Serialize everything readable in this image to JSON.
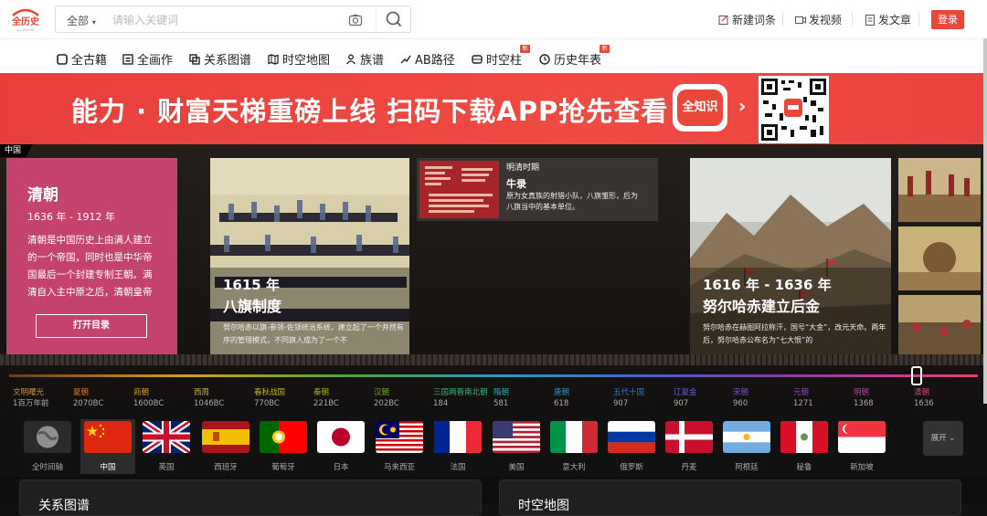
{
  "header": {
    "logo_text": "全历史",
    "logo_sub": "ALL HISTORY",
    "search": {
      "scope": "全部",
      "placeholder": "请输入关键词"
    },
    "actions": [
      {
        "label": "新建词条",
        "icon": "new-entry-icon"
      },
      {
        "label": "发视频",
        "icon": "video-icon"
      },
      {
        "label": "发文章",
        "icon": "article-icon"
      }
    ],
    "login_label": "登录"
  },
  "nav": {
    "items": [
      {
        "label": "全古籍",
        "icon": "book-icon"
      },
      {
        "label": "全画作",
        "icon": "painting-icon"
      },
      {
        "label": "关系图谱",
        "icon": "relation-icon"
      },
      {
        "label": "时空地图",
        "icon": "map-icon"
      },
      {
        "label": "族谱",
        "icon": "family-icon"
      },
      {
        "label": "AB路径",
        "icon": "path-icon"
      },
      {
        "label": "时空柱",
        "icon": "pillar-icon",
        "badge": "新"
      },
      {
        "label": "历史年表",
        "icon": "clock-icon",
        "badge": "新"
      }
    ]
  },
  "banner": {
    "text": "能力 · 财富天梯重磅上线 扫码下载APP抢先查看",
    "app_label": "全知识",
    "arrow": "›",
    "accent": "#e8473a"
  },
  "stage": {
    "region_tag": "中国",
    "dynasty": {
      "name": "清朝",
      "years": "1636 年 - 1912 年",
      "description": "清朝是中国历史上由满人建立的一个帝国，同时也是中华帝国最后一个封建专制王朝。满清自入主中原之后，清朝皇帝",
      "open_label": "打开目录",
      "color": "#d34876"
    },
    "cards": [
      {
        "year": "1615 年",
        "title": "八旗制度",
        "description": "努尔哈赤以旗-参领-佐领统治系统，建立起了一个井然有序的管理模式，不同旗人成为了一个不"
      },
      {
        "year": "1616 年 - 1636 年",
        "title": "努尔哈赤建立后金",
        "description": "努尔哈赤在赫图阿拉称汗，国号“大金”，改元天命。两年后，努尔哈赤公布名为“七大恨”的"
      }
    ],
    "period_card": {
      "era": "明清时期",
      "title": "牛录",
      "description": "原为女真族的射猎小队，八旗雏形，后为八旗当中的基本单位。"
    }
  },
  "timeline": {
    "eras": [
      {
        "name": "文明曙光",
        "year": "1百万年前",
        "color": "#d68a2a"
      },
      {
        "name": "夏朝",
        "year": "2070BC",
        "color": "#e0761e"
      },
      {
        "name": "商朝",
        "year": "1600BC",
        "color": "#e29b20"
      },
      {
        "name": "西周",
        "year": "1046BC",
        "color": "#d5b11d"
      },
      {
        "name": "春秋战国",
        "year": "770BC",
        "color": "#c5b629"
      },
      {
        "name": "秦朝",
        "year": "221BC",
        "color": "#a4b52c"
      },
      {
        "name": "汉朝",
        "year": "202BC",
        "color": "#6fae34"
      },
      {
        "name": "三国两晋南北朝",
        "year": "184",
        "color": "#3fae7a"
      },
      {
        "name": "隋朝",
        "year": "581",
        "color": "#2fa6b9"
      },
      {
        "name": "唐朝",
        "year": "618",
        "color": "#2b93d0"
      },
      {
        "name": "五代十国",
        "year": "907",
        "color": "#3b74d2"
      },
      {
        "name": "辽夏金",
        "year": "907",
        "color": "#5b5fd0"
      },
      {
        "name": "宋朝",
        "year": "960",
        "color": "#7b4ccf"
      },
      {
        "name": "元朝",
        "year": "1271",
        "color": "#9b40c0"
      },
      {
        "name": "明朝",
        "year": "1368",
        "color": "#b43fa6"
      },
      {
        "name": "清朝",
        "year": "1636",
        "color": "#e63f80"
      }
    ]
  },
  "countries": {
    "items": [
      {
        "name": "全时间轴",
        "flag": "globe-icon"
      },
      {
        "name": "中国",
        "flag": "china-flag",
        "selected": true
      },
      {
        "name": "英国",
        "flag": "uk-flag"
      },
      {
        "name": "西班牙",
        "flag": "spain-flag"
      },
      {
        "name": "葡萄牙",
        "flag": "portugal-flag"
      },
      {
        "name": "日本",
        "flag": "japan-flag"
      },
      {
        "name": "马来西亚",
        "flag": "malaysia-flag"
      },
      {
        "name": "法国",
        "flag": "france-flag"
      },
      {
        "name": "美国",
        "flag": "usa-flag"
      },
      {
        "name": "意大利",
        "flag": "italy-flag"
      },
      {
        "name": "俄罗斯",
        "flag": "russia-flag"
      },
      {
        "name": "丹麦",
        "flag": "denmark-flag"
      },
      {
        "name": "阿根廷",
        "flag": "argentina-flag"
      },
      {
        "name": "秘鲁",
        "flag": "peru-flag"
      },
      {
        "name": "新加坡",
        "flag": "singapore-flag"
      }
    ],
    "expand_label": "展开"
  },
  "panels": {
    "left_title": "关系图谱",
    "right_title": "时空地图"
  }
}
